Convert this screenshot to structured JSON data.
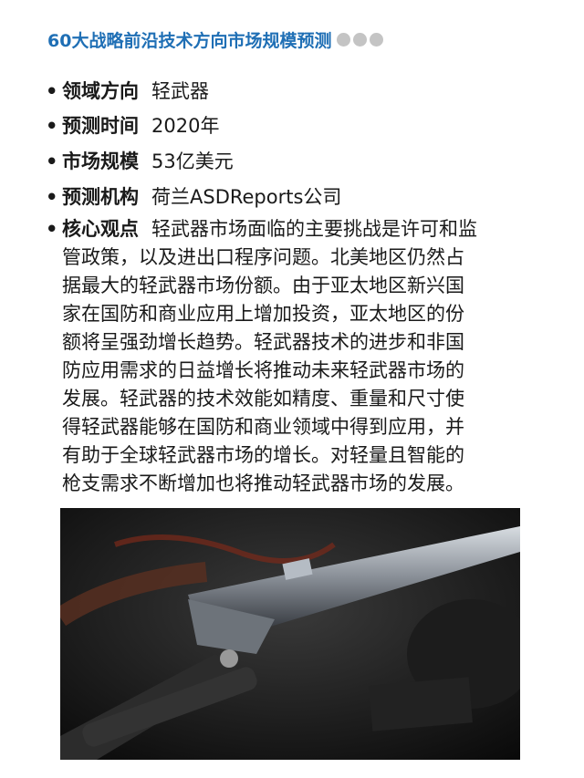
{
  "header": {
    "title": "60大战略前沿技术方向市场规模预测",
    "accent_color": "#1f6fb5",
    "dots_color": "#c4c4c4"
  },
  "items": [
    {
      "label": "领域方向",
      "value": "轻武器"
    },
    {
      "label": "预测时间",
      "value": "2020年"
    },
    {
      "label": "市场规模",
      "value": "53亿美元"
    },
    {
      "label": "预测机构",
      "value": "荷兰ASDReports公司"
    }
  ],
  "core": {
    "label": "核心观点",
    "lines": [
      "轻武器市场面临的主要挑战是许可和监",
      "管政策，以及进出口程序问题。北美地区仍然占",
      "据最大的轻武器市场份额。由于亚太地区新兴国",
      "家在国防和商业应用上增加投资，亚太地区的份",
      "额将呈强劲增长趋势。轻武器技术的进步和非国",
      "防应用需求的日益增长将推动未来轻武器市场的",
      "发展。轻武器的技术效能如精度、重量和尺寸使",
      "得轻武器能够在国防和商业领域中得到应用，并",
      "有助于全球轻武器市场的增长。对轻量且智能的",
      "枪支需求不断增加也将推动轻武器市场的发展。"
    ]
  },
  "photo": {
    "subject": "rifle"
  }
}
